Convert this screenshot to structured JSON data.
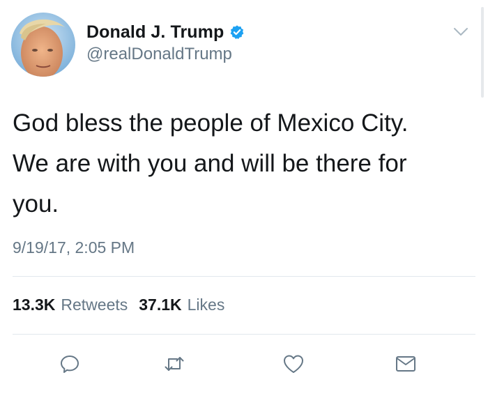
{
  "user": {
    "display_name": "Donald J. Trump",
    "handle": "@realDonaldTrump",
    "verified": true
  },
  "tweet": {
    "text": "God bless the people of Mexico City.\nWe are with you and will be there for\nyou.",
    "timestamp": "9/19/17, 2:05 PM"
  },
  "stats": {
    "retweets_count": "13.3K",
    "retweets_label": "Retweets",
    "likes_count": "37.1K",
    "likes_label": "Likes"
  },
  "icons": {
    "reply": "reply-icon",
    "retweet": "retweet-icon",
    "like": "heart-icon",
    "dm": "envelope-icon",
    "menu": "chevron-down-icon",
    "verified": "verified-badge-icon"
  },
  "colors": {
    "text": "#14171a",
    "secondary": "#657786",
    "verified": "#1da1f2",
    "divider": "#e1e8ed"
  }
}
